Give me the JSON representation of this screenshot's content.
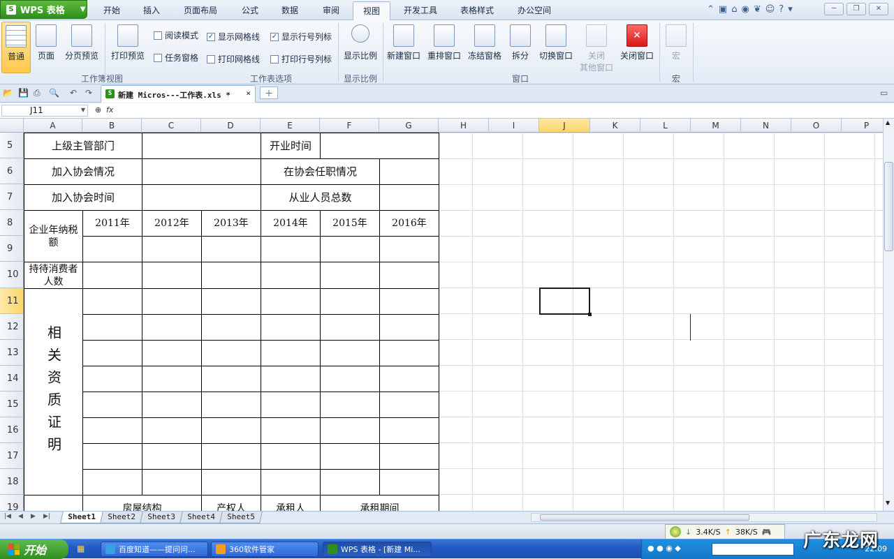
{
  "app": {
    "button_label": "WPS 表格",
    "menus": [
      "开始",
      "插入",
      "页面布局",
      "公式",
      "数据",
      "审阅",
      "视图",
      "开发工具",
      "表格样式",
      "办公空间"
    ],
    "active_menu": "视图"
  },
  "ribbon": {
    "workbook_views": {
      "group_label": "工作簿视图",
      "buttons": [
        "普通",
        "页面",
        "分页预览"
      ],
      "active": "普通"
    },
    "print_preview": "打印预览",
    "sheet_options": {
      "group_label": "工作表选项",
      "checkboxes": [
        {
          "label": "阅读模式",
          "checked": false
        },
        {
          "label": "任务窗格",
          "checked": false
        },
        {
          "label": "显示网格线",
          "checked": true
        },
        {
          "label": "打印网格线",
          "checked": false
        },
        {
          "label": "显示行号列标",
          "checked": true
        },
        {
          "label": "打印行号列标",
          "checked": false
        }
      ]
    },
    "zoom": {
      "group_label": "显示比例",
      "button": "显示比例"
    },
    "window": {
      "group_label": "窗口",
      "buttons": [
        "新建窗口",
        "重排窗口",
        "冻结窗格",
        "拆分",
        "切换窗口",
        "关闭其他窗口",
        "关闭窗口"
      ],
      "close_other_line1": "关闭",
      "close_other_line2": "其他窗口"
    },
    "macro": {
      "group_label": "宏",
      "button": "宏"
    }
  },
  "document_tab": {
    "title": "新建 Micros---工作表.xls *",
    "close": "×"
  },
  "formula_bar": {
    "name_box": "J11",
    "fx": "fx",
    "content": ""
  },
  "columns": [
    "A",
    "B",
    "C",
    "D",
    "E",
    "F",
    "G",
    "H",
    "I",
    "J",
    "K",
    "L",
    "M",
    "N",
    "O",
    "P"
  ],
  "selected_column": "J",
  "rows": [
    "5",
    "6",
    "7",
    "8",
    "9",
    "10",
    "11",
    "12",
    "13",
    "14",
    "15",
    "16",
    "17",
    "18",
    "19"
  ],
  "selected_row": "11",
  "cells": {
    "a5": "上级主管部门",
    "e5": "开业时间",
    "a6": "加入协会情况",
    "e6": "在协会任职情况",
    "a7": "加入协会时间",
    "e7": "从业人员总数",
    "a8": "企业年纳税额",
    "years": [
      "2011年",
      "2012年",
      "2013年",
      "2014年",
      "2015年",
      "2016年"
    ],
    "a10": "持待消费者人数",
    "a11": "相关资质证明",
    "row19": [
      "房屋结构",
      "产权人",
      "承租人",
      "承租期间"
    ]
  },
  "sheet_tabs": [
    "Sheet1",
    "Sheet2",
    "Sheet3",
    "Sheet4",
    "Sheet5"
  ],
  "active_sheet": "Sheet1",
  "status_bar": {
    "download": "3.4K/S",
    "upload": "38K/S"
  },
  "taskbar": {
    "start": "开始",
    "tasks": [
      {
        "label": "百度知道——提问问...",
        "active": false
      },
      {
        "label": "360软件管家",
        "active": false
      },
      {
        "label": "WPS 表格 - [新建 Mi...",
        "active": true
      }
    ],
    "clock": "22:09"
  },
  "watermark": "广东龙网"
}
